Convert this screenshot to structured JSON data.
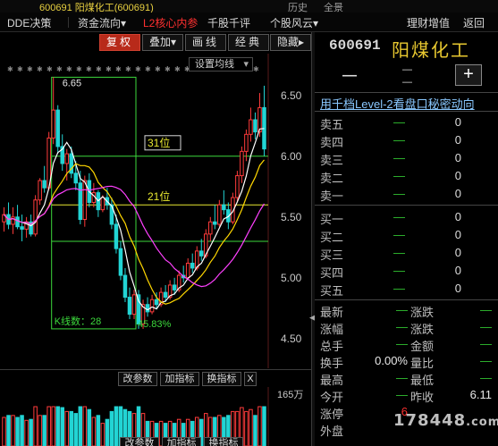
{
  "topbar": {
    "code_text": "600691 阳煤化工(600691)",
    "right_items": [
      {
        "label": "历史"
      },
      {
        "label": "全景"
      }
    ]
  },
  "menubar": {
    "items": [
      {
        "label": "DDE决策"
      },
      {
        "label": "资金流向▾"
      },
      {
        "label": "L2核心内参"
      },
      {
        "label": "千股千评"
      },
      {
        "label": "个股风云▾"
      },
      {
        "label": "理财增值"
      },
      {
        "label": "返回"
      }
    ]
  },
  "toolbar": {
    "buttons": [
      {
        "label": "复权"
      },
      {
        "label": "叠加▾"
      },
      {
        "label": "画线"
      },
      {
        "label": "经典"
      },
      {
        "label": "隐藏▸"
      }
    ],
    "setting_label": "设置均线",
    "setting_caret": "▾"
  },
  "chart": {
    "price_labels": [
      "6.50",
      "6.00",
      "5.50",
      "5.00",
      "4.50"
    ],
    "high_label": "6.65",
    "fib_labels": [
      "31位",
      "21位"
    ],
    "kline_count": "K线数：28",
    "percent_label": "45.83%",
    "colors": {
      "up": "#ff3b3b",
      "down": "#22d4d4",
      "ma5": "#ffffff",
      "ma10": "#ffd700",
      "ma20": "#ff40ff",
      "ma60": "#40ff40",
      "box": "#3cd83c"
    }
  },
  "chart_data": {
    "type": "candlestick",
    "ylim": [
      4.3,
      6.8
    ],
    "candles": [
      {
        "o": 5.46,
        "h": 5.58,
        "l": 5.38,
        "c": 5.52
      },
      {
        "o": 5.52,
        "h": 5.62,
        "l": 5.4,
        "c": 5.44
      },
      {
        "o": 5.44,
        "h": 5.58,
        "l": 5.36,
        "c": 5.5
      },
      {
        "o": 5.5,
        "h": 5.6,
        "l": 5.4,
        "c": 5.42
      },
      {
        "o": 5.42,
        "h": 5.52,
        "l": 5.3,
        "c": 5.4
      },
      {
        "o": 5.4,
        "h": 5.5,
        "l": 5.33,
        "c": 5.46
      },
      {
        "o": 5.46,
        "h": 5.52,
        "l": 5.34,
        "c": 5.36
      },
      {
        "o": 5.36,
        "h": 5.68,
        "l": 5.34,
        "c": 5.64
      },
      {
        "o": 5.64,
        "h": 5.82,
        "l": 5.6,
        "c": 5.8
      },
      {
        "o": 5.8,
        "h": 5.92,
        "l": 5.7,
        "c": 5.74
      },
      {
        "o": 5.74,
        "h": 6.2,
        "l": 5.72,
        "c": 6.15
      },
      {
        "o": 6.15,
        "h": 6.65,
        "l": 6.1,
        "c": 6.38
      },
      {
        "o": 6.38,
        "h": 6.42,
        "l": 6.02,
        "c": 6.08
      },
      {
        "o": 6.08,
        "h": 6.18,
        "l": 5.88,
        "c": 5.94
      },
      {
        "o": 5.94,
        "h": 6.06,
        "l": 5.8,
        "c": 6.02
      },
      {
        "o": 6.02,
        "h": 6.08,
        "l": 5.82,
        "c": 5.86
      },
      {
        "o": 5.86,
        "h": 5.96,
        "l": 5.72,
        "c": 5.78
      },
      {
        "o": 5.78,
        "h": 5.88,
        "l": 5.44,
        "c": 5.48
      },
      {
        "o": 5.48,
        "h": 5.84,
        "l": 5.42,
        "c": 5.8
      },
      {
        "o": 5.8,
        "h": 5.86,
        "l": 5.58,
        "c": 5.62
      },
      {
        "o": 5.62,
        "h": 5.78,
        "l": 5.58,
        "c": 5.7
      },
      {
        "o": 5.7,
        "h": 5.72,
        "l": 5.5,
        "c": 5.56
      },
      {
        "o": 5.56,
        "h": 5.68,
        "l": 5.54,
        "c": 5.66
      },
      {
        "o": 5.66,
        "h": 5.74,
        "l": 5.56,
        "c": 5.6
      },
      {
        "o": 5.6,
        "h": 5.66,
        "l": 5.4,
        "c": 5.44
      },
      {
        "o": 5.44,
        "h": 5.52,
        "l": 5.2,
        "c": 5.24
      },
      {
        "o": 5.24,
        "h": 5.3,
        "l": 4.98,
        "c": 5.02
      },
      {
        "o": 5.02,
        "h": 5.08,
        "l": 4.8,
        "c": 4.84
      },
      {
        "o": 4.84,
        "h": 4.92,
        "l": 4.66,
        "c": 4.7
      },
      {
        "o": 4.7,
        "h": 4.9,
        "l": 4.66,
        "c": 4.86
      },
      {
        "o": 4.86,
        "h": 4.9,
        "l": 4.58,
        "c": 4.62
      },
      {
        "o": 4.62,
        "h": 4.82,
        "l": 4.58,
        "c": 4.78
      },
      {
        "o": 4.78,
        "h": 4.84,
        "l": 4.68,
        "c": 4.72
      },
      {
        "o": 4.72,
        "h": 4.86,
        "l": 4.7,
        "c": 4.82
      },
      {
        "o": 4.82,
        "h": 4.88,
        "l": 4.74,
        "c": 4.78
      },
      {
        "o": 4.78,
        "h": 4.92,
        "l": 4.76,
        "c": 4.88
      },
      {
        "o": 4.88,
        "h": 4.94,
        "l": 4.8,
        "c": 4.84
      },
      {
        "o": 4.84,
        "h": 4.98,
        "l": 4.82,
        "c": 4.94
      },
      {
        "o": 4.94,
        "h": 5.0,
        "l": 4.86,
        "c": 4.9
      },
      {
        "o": 4.9,
        "h": 5.06,
        "l": 4.88,
        "c": 5.02
      },
      {
        "o": 5.02,
        "h": 5.1,
        "l": 4.96,
        "c": 5.0
      },
      {
        "o": 5.0,
        "h": 5.16,
        "l": 4.98,
        "c": 5.12
      },
      {
        "o": 5.12,
        "h": 5.2,
        "l": 5.04,
        "c": 5.08
      },
      {
        "o": 5.08,
        "h": 5.26,
        "l": 5.06,
        "c": 5.22
      },
      {
        "o": 5.22,
        "h": 5.32,
        "l": 5.14,
        "c": 5.18
      },
      {
        "o": 5.18,
        "h": 5.4,
        "l": 5.16,
        "c": 5.36
      },
      {
        "o": 5.36,
        "h": 5.5,
        "l": 5.3,
        "c": 5.46
      },
      {
        "o": 5.46,
        "h": 5.6,
        "l": 5.4,
        "c": 5.44
      },
      {
        "o": 5.44,
        "h": 5.64,
        "l": 5.42,
        "c": 5.6
      },
      {
        "o": 5.6,
        "h": 5.72,
        "l": 5.52,
        "c": 5.56
      },
      {
        "o": 5.56,
        "h": 5.62,
        "l": 5.4,
        "c": 5.46
      },
      {
        "o": 5.46,
        "h": 5.7,
        "l": 5.44,
        "c": 5.66
      },
      {
        "o": 5.66,
        "h": 5.88,
        "l": 5.62,
        "c": 5.84
      },
      {
        "o": 5.84,
        "h": 6.08,
        "l": 5.78,
        "c": 6.04
      },
      {
        "o": 6.04,
        "h": 6.22,
        "l": 5.96,
        "c": 6.18
      },
      {
        "o": 6.18,
        "h": 6.4,
        "l": 6.12,
        "c": 6.3
      },
      {
        "o": 6.3,
        "h": 6.36,
        "l": 6.14,
        "c": 6.2
      },
      {
        "o": 6.2,
        "h": 6.52,
        "l": 6.16,
        "c": 6.4
      },
      {
        "o": 6.4,
        "h": 6.58,
        "l": 6.0,
        "c": 6.06
      }
    ]
  },
  "indicator_bar": {
    "buttons": [
      {
        "label": "改参数"
      },
      {
        "label": "加指标"
      },
      {
        "label": "换指标"
      }
    ],
    "close_label": "X",
    "vol_label": "165万"
  },
  "bottom_bar": {
    "buttons": [
      {
        "label": "改参数"
      },
      {
        "label": "加指标"
      },
      {
        "label": "换指标"
      }
    ]
  },
  "quote": {
    "code": "600691",
    "name": "阳煤化工",
    "price": "—",
    "change_top": "—",
    "change_bottom": "—",
    "add_label": "+",
    "l2_link": "用千档Level-2看盘口秘密动向",
    "asks": [
      {
        "label": "卖五",
        "price": "—",
        "vol": "0"
      },
      {
        "label": "卖四",
        "price": "—",
        "vol": "0"
      },
      {
        "label": "卖三",
        "price": "—",
        "vol": "0"
      },
      {
        "label": "卖二",
        "price": "—",
        "vol": "0"
      },
      {
        "label": "卖一",
        "price": "—",
        "vol": "0"
      }
    ],
    "bids": [
      {
        "label": "买一",
        "price": "—",
        "vol": "0"
      },
      {
        "label": "买二",
        "price": "—",
        "vol": "0"
      },
      {
        "label": "买三",
        "price": "—",
        "vol": "0"
      },
      {
        "label": "买四",
        "price": "—",
        "vol": "0"
      },
      {
        "label": "买五",
        "price": "—",
        "vol": "0"
      }
    ],
    "stats": [
      {
        "l1": "最新",
        "v1": "—",
        "l2": "涨跌",
        "v2": "—"
      },
      {
        "l1": "涨幅",
        "v1": "—",
        "l2": "涨跌",
        "v2": "—"
      },
      {
        "l1": "总手",
        "v1": "—",
        "l2": "金额",
        "v2": "—"
      },
      {
        "l1": "换手",
        "v1": "0.00%",
        "l2": "量比",
        "v2": "—"
      },
      {
        "l1": "最高",
        "v1": "—",
        "l2": "最低",
        "v2": "—"
      },
      {
        "l1": "今开",
        "v1": "—",
        "l2": "昨收",
        "v2": "6.11"
      },
      {
        "l1": "涨停",
        "v1": "6",
        "l2": "",
        "v2": ""
      },
      {
        "l1": "外盘",
        "v1": "",
        "l2": "",
        "v2": ""
      }
    ]
  },
  "watermark": {
    "text": "178448",
    "suffix": ".com"
  }
}
